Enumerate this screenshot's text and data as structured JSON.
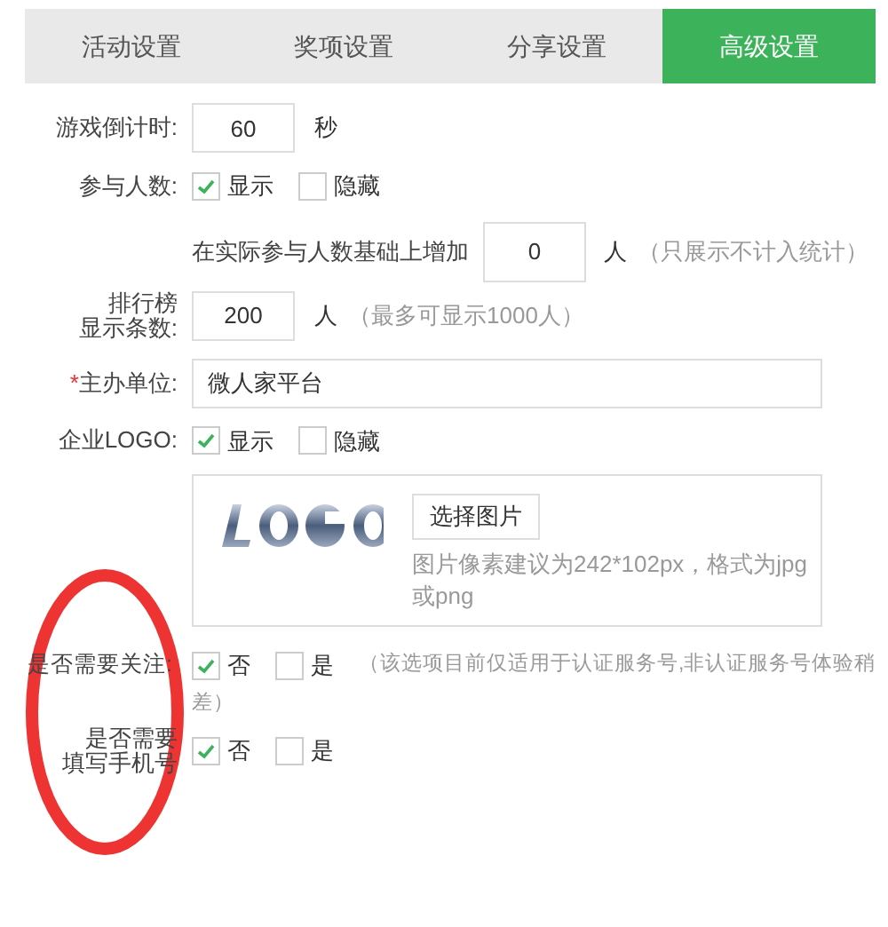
{
  "tabs": [
    {
      "label": "活动设置",
      "selected": false
    },
    {
      "label": "奖项设置",
      "selected": false
    },
    {
      "label": "分享设置",
      "selected": false
    },
    {
      "label": "高级设置",
      "selected": true
    }
  ],
  "countdown": {
    "label": "游戏倒计时:",
    "value": "60",
    "unit": "秒"
  },
  "participants": {
    "label": "参与人数:",
    "options": [
      {
        "label": "显示",
        "checked": true
      },
      {
        "label": "隐藏",
        "checked": false
      }
    ],
    "extra_prefix": "在实际参与人数基础上增加",
    "extra_value": "0",
    "extra_unit": "人",
    "extra_note": "（只展示不计入统计）"
  },
  "ranking": {
    "label_lines": [
      "排行榜",
      "显示条数:"
    ],
    "value": "200",
    "unit": "人",
    "note": "（最多可显示1000人）"
  },
  "organizer": {
    "required_mark": "*",
    "label": "主办单位:",
    "value": "微人家平台"
  },
  "logo": {
    "label": "企业LOGO:",
    "options": [
      {
        "label": "显示",
        "checked": true
      },
      {
        "label": "隐藏",
        "checked": false
      }
    ],
    "button": "选择图片",
    "hint": "图片像素建议为242*102px，格式为jpg或png"
  },
  "follow": {
    "label": "是否需要关注:",
    "options": [
      {
        "label": "否",
        "checked": true
      },
      {
        "label": "是",
        "checked": false
      }
    ],
    "note_lines": [
      "（该选项目前仅适用于认证服务号,非认证服务号体验稍",
      "差）"
    ]
  },
  "phone": {
    "label_lines": [
      "是否需要",
      "填写手机号"
    ],
    "options": [
      {
        "label": "否",
        "checked": true
      },
      {
        "label": "是",
        "checked": false
      }
    ]
  },
  "annotations": [
    {
      "kind": "ellipse",
      "color": "#ee3333"
    }
  ]
}
